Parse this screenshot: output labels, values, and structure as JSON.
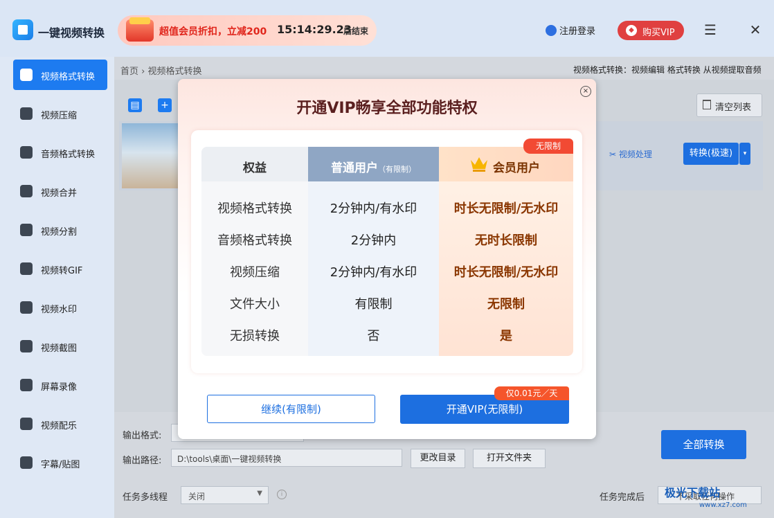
{
  "app": {
    "title": "一键视频转换"
  },
  "promo": {
    "text": "超值会员折扣，立减200",
    "countdown": "15:14:29.23",
    "suffix": "后结束"
  },
  "header": {
    "login": "注册登录",
    "buy_vip": "购买VIP",
    "menu_icon": "☰",
    "close_icon": "✕"
  },
  "sidebar": {
    "items": [
      {
        "label": "视频格式转换",
        "icon": "video-convert-icon",
        "active": true
      },
      {
        "label": "视频压缩",
        "icon": "compress-icon"
      },
      {
        "label": "音频格式转换",
        "icon": "audio-convert-icon"
      },
      {
        "label": "视频合并",
        "icon": "merge-icon"
      },
      {
        "label": "视频分割",
        "icon": "split-icon"
      },
      {
        "label": "视频转GIF",
        "icon": "gif-icon"
      },
      {
        "label": "视频水印",
        "icon": "watermark-icon"
      },
      {
        "label": "视频截图",
        "icon": "screenshot-icon"
      },
      {
        "label": "屏幕录像",
        "icon": "record-icon"
      },
      {
        "label": "视频配乐",
        "icon": "music-icon"
      },
      {
        "label": "字幕/贴图",
        "icon": "subtitle-icon"
      }
    ]
  },
  "breadcrumb": {
    "home": "首页",
    "sep": "›",
    "current": "视频格式转换"
  },
  "crumb_right": "视频格式转换：视频编辑 格式转换 从视频提取音频",
  "toolbar": {
    "add_file": "▤",
    "add_folder": "+",
    "clear": "清空列表"
  },
  "file_row": {
    "video_process": "视频处理",
    "convert": "转换(极速)",
    "dropdown": "▾"
  },
  "output": {
    "format_label": "输出格式:",
    "path_label": "输出路径:",
    "path": "D:\\tools\\桌面\\一键视频转换",
    "change_dir": "更改目录",
    "open_folder": "打开文件夹",
    "convert_all": "全部转换"
  },
  "bottom": {
    "threads_label": "任务多线程",
    "threads_value": "关闭",
    "after_label": "任务完成后",
    "after_value": "不采取任何操作"
  },
  "watermark": {
    "text": "极光下载站",
    "url": "www.xz7.com"
  },
  "modal": {
    "title": "开通VIP畅享全部功能特权",
    "badge": "无限制",
    "headers": {
      "col1": "权益",
      "col2": "普通用户",
      "col2_note": "（有限制）",
      "col3": "会员用户"
    },
    "rows": [
      {
        "feature": "视频格式转换",
        "normal": "2分钟内/有水印",
        "vip": "时长无限制/无水印"
      },
      {
        "feature": "音频格式转换",
        "normal": "2分钟内",
        "vip": "无时长限制"
      },
      {
        "feature": "视频压缩",
        "normal": "2分钟内/有水印",
        "vip": "时长无限制/无水印"
      },
      {
        "feature": "文件大小",
        "normal": "有限制",
        "vip": "无限制"
      },
      {
        "feature": "无损转换",
        "normal": "否",
        "vip": "是"
      }
    ],
    "continue_label": "继续(有限制)",
    "vip_label": "开通VIP(无限制)",
    "price_badge": "仅0.01元／天",
    "close_icon": "×"
  },
  "colors": {
    "accent": "#1d6fe0",
    "promo_red": "#e0261c",
    "vip_text": "#8a3600",
    "badge_red": "#f24a33"
  }
}
